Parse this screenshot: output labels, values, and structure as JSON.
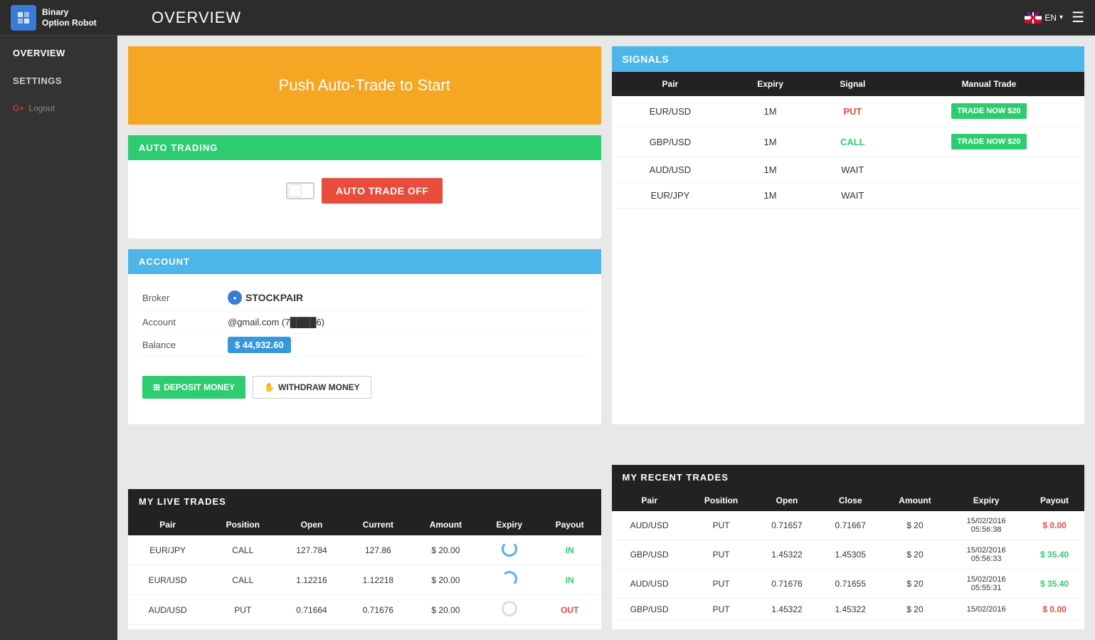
{
  "header": {
    "logo_line1": "Binary",
    "logo_line2": "Option Robot",
    "title": "OVERVIEW",
    "language": "EN"
  },
  "sidebar": {
    "items": [
      {
        "label": "OVERVIEW",
        "active": true
      },
      {
        "label": "SETTINGS",
        "active": false
      }
    ],
    "logout": "Logout"
  },
  "push_autotrade": {
    "text": "Push Auto-Trade to Start"
  },
  "auto_trading": {
    "header": "AUTO TRADING",
    "button_label": "AUTO TRADE OFF"
  },
  "account": {
    "header": "ACCOUNT",
    "broker_label": "Broker",
    "broker_name": "STOCKPAIR",
    "account_label": "Account",
    "account_value": "@gmail.com (7████6)",
    "balance_label": "Balance",
    "balance_value": "$ 44,932.60",
    "deposit_label": "DEPOSIT MONEY",
    "withdraw_label": "WITHDRAW MONEY"
  },
  "signals": {
    "header": "SIGNALS",
    "columns": [
      "Pair",
      "Expiry",
      "Signal",
      "Manual Trade"
    ],
    "rows": [
      {
        "pair": "EUR/USD",
        "expiry": "1M",
        "signal": "PUT",
        "signal_type": "put",
        "trade": "TRADE NOW $20"
      },
      {
        "pair": "GBP/USD",
        "expiry": "1M",
        "signal": "CALL",
        "signal_type": "call",
        "trade": "TRADE NOW $20"
      },
      {
        "pair": "AUD/USD",
        "expiry": "1M",
        "signal": "WAIT",
        "signal_type": "wait",
        "trade": ""
      },
      {
        "pair": "EUR/JPY",
        "expiry": "1M",
        "signal": "WAIT",
        "signal_type": "wait",
        "trade": ""
      }
    ]
  },
  "live_trades": {
    "header": "MY LIVE TRADES",
    "columns": [
      "Pair",
      "Position",
      "Open",
      "Current",
      "Amount",
      "Expiry",
      "Payout"
    ],
    "rows": [
      {
        "pair": "EUR/JPY",
        "position": "CALL",
        "open": "127.784",
        "current": "127.86",
        "amount": "$ 20.00",
        "expiry": "spinner",
        "payout": "IN",
        "payout_type": "in"
      },
      {
        "pair": "EUR/USD",
        "position": "CALL",
        "open": "1.12216",
        "current": "1.12218",
        "amount": "$ 20.00",
        "expiry": "spinner_half",
        "payout": "IN",
        "payout_type": "in"
      },
      {
        "pair": "AUD/USD",
        "position": "PUT",
        "open": "0.71664",
        "current": "0.71676",
        "amount": "$ 20.00",
        "expiry": "spinner_gray",
        "payout": "OUT",
        "payout_type": "out"
      }
    ]
  },
  "recent_trades": {
    "header": "MY RECENT TRADES",
    "columns": [
      "Pair",
      "Position",
      "Open",
      "Close",
      "Amount",
      "Expiry",
      "Payout"
    ],
    "rows": [
      {
        "pair": "AUD/USD",
        "position": "PUT",
        "open": "0.71657",
        "close": "0.71667",
        "amount": "$ 20",
        "expiry": "15/02/2016\n05:56:38",
        "payout": "$ 0.00",
        "payout_type": "red"
      },
      {
        "pair": "GBP/USD",
        "position": "PUT",
        "open": "1.45322",
        "close": "1.45305",
        "amount": "$ 20",
        "expiry": "15/02/2016\n05:56:33",
        "payout": "$ 35.40",
        "payout_type": "green"
      },
      {
        "pair": "AUD/USD",
        "position": "PUT",
        "open": "0.71676",
        "close": "0.71655",
        "amount": "$ 20",
        "expiry": "15/02/2016\n05:55:31",
        "payout": "$ 35.40",
        "payout_type": "green"
      },
      {
        "pair": "GBP/USD",
        "position": "PUT",
        "open": "1.45322",
        "close": "1.45322",
        "amount": "$ 20",
        "expiry": "15/02/2016",
        "payout": "$ 0.00",
        "payout_type": "red"
      }
    ]
  }
}
